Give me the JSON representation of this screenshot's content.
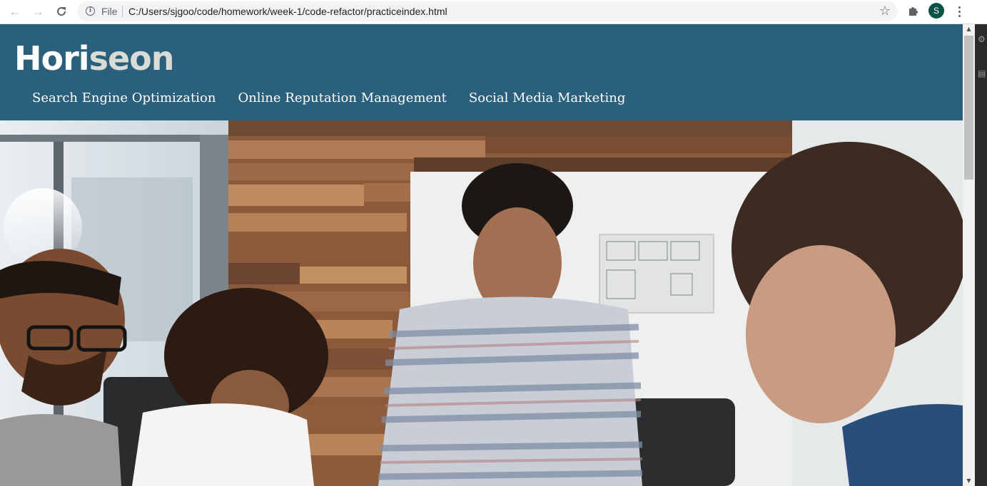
{
  "browser": {
    "scheme_label": "File",
    "url": "C:/Users/sjgoo/code/homework/week-1/code-refactor/practiceindex.html",
    "profile_initial": "S",
    "icons": {
      "back": "arrow-left-icon",
      "forward": "arrow-right-icon",
      "reload": "reload-icon",
      "info": "info-icon",
      "bookmark": "star-icon",
      "extensions": "puzzle-icon",
      "menu": "kebab-menu-icon"
    }
  },
  "site": {
    "logo_part1": "Hori",
    "logo_part2": "seon",
    "nav": [
      {
        "label": "Search Engine Optimization"
      },
      {
        "label": "Online Reputation Management"
      },
      {
        "label": "Social Media Marketing"
      }
    ],
    "colors": {
      "header_bg": "#2a607c",
      "logo_accent": "#d9dcd6",
      "text": "#ffffff"
    }
  }
}
